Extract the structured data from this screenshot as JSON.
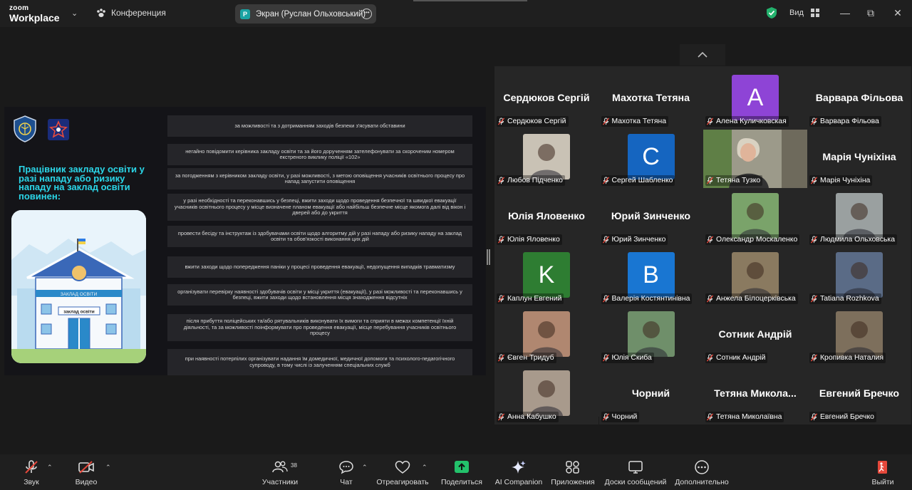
{
  "titlebar": {
    "logo_top": "zoom",
    "logo_bottom": "Workplace",
    "meeting_label": "Конференция",
    "share_initial": "P",
    "share_label": "Экран (Руслан Ольховський)",
    "view_label": "Вид"
  },
  "slide": {
    "title": "Працівник закладу освіти у разі нападу або ризику нападу на заклад освіти повинен:",
    "school_label": "заклад освіти",
    "banner_text": "ЗАКЛАД ОСВІТИ",
    "rows": [
      "за можливості та з дотриманням заходів безпеки з'ясувати обставини",
      "негайно повідомити керівника закладу освіти та за його дорученням  зателефонувати за скороченим номером екстреного виклику поліції «102»",
      "за погодженням з керівником закладу освіти, у разі можливості, з метою оповіщення учасників освітнього процесу про напад запустити оповіщення",
      "у разі необхідності та переконавшись у безпеці, вжити заходи щодо проведення безпечної та швидкої евакуації учасників освітнього процесу у місце визначене планом евакуації або найбільш безпечне місце якомога далі від вікон і дверей або до укриття",
      "провести бесіду та інструктаж із здобувачами освіти щодо алгоритму дій у разі нападу або ризику нападу на заклад освіти та обов'язкості виконання цих дій",
      "вжити заходи щодо попередження паніки у процесі проведення евакуації, недопущення випадків травматизму",
      "організувати перевірку наявності здобувачів освіти у місці укриття (евакуації), у разі можливості та переконавшись у безпеці, вжити заходи щодо встановлення місця знаходження відсутніх",
      "після прибуття поліцейських та/або рятувальників виконувати їх вимоги та сприяти в межах компетенції їхній діяльності, та за можливості поінформувати про проведення евакуації, місце перебування учасників освітнього процесу",
      "при наявності потерпілих організувати надання їм домедичної, медичної допомоги та психолого-педагогічного супроводу, в тому числі із залученням спеціальних служб"
    ]
  },
  "participants": [
    {
      "name": "Сердюков Сергій",
      "display": "Сердюков  Сергій",
      "kind": "name"
    },
    {
      "name": "Махотка Тетяна",
      "display": "Махотка Тетяна",
      "kind": "name"
    },
    {
      "name": "Алена Куличковская",
      "letter": "A",
      "color": "#8e44d6",
      "kind": "letter"
    },
    {
      "name": "Варвара Фільова",
      "display": "Варвара Фільова",
      "kind": "name"
    },
    {
      "name": "Любов Підченко",
      "kind": "photo",
      "color": "#c9c2b5"
    },
    {
      "name": "Сергей Шабленко",
      "letter": "C",
      "color": "#1565c0",
      "kind": "letter"
    },
    {
      "name": "Тетяна Тузко",
      "kind": "video",
      "color": "#8a8a82"
    },
    {
      "name": "Марія Чуніхіна",
      "display": "Марія Чуніхіна",
      "kind": "name"
    },
    {
      "name": "Юлія Яловенко",
      "display": "Юлія Яловенко",
      "kind": "name"
    },
    {
      "name": "Юрий Зинченко",
      "display": "Юрий Зинченко",
      "kind": "name"
    },
    {
      "name": "Олександр Москаленко",
      "kind": "photo",
      "color": "#7aa36a"
    },
    {
      "name": "Людмила Ольховська",
      "kind": "photo",
      "color": "#9aa0a0"
    },
    {
      "name": "Каплун Евгений",
      "letter": "K",
      "color": "#2e7d32",
      "kind": "letter"
    },
    {
      "name": "Валерія Костянтинівна",
      "letter": "B",
      "color": "#1976d2",
      "kind": "letter"
    },
    {
      "name": "Анжела Білоцерківська",
      "kind": "photo",
      "color": "#8a7a60"
    },
    {
      "name": "Tatiana Rozhkova",
      "kind": "photo",
      "color": "#5a6b86"
    },
    {
      "name": "Євген Тридуб",
      "kind": "photo",
      "color": "#b08770"
    },
    {
      "name": "Юлія Скиба",
      "kind": "photo",
      "color": "#6f8f6a"
    },
    {
      "name": "Сотник Андрій",
      "display": "Сотник Андрій",
      "kind": "name"
    },
    {
      "name": "Кропивка Наталия",
      "kind": "photo",
      "color": "#7d6f5c"
    },
    {
      "name": "Анна Кабушко",
      "kind": "photo",
      "color": "#a89a8c"
    },
    {
      "name": "Чорний",
      "display": "Чорний",
      "kind": "name"
    },
    {
      "name": "Тетяна Миколаївна",
      "display": "Тетяна  Микола...",
      "kind": "name"
    },
    {
      "name": "Евгений Бречко",
      "display": "Евгений Бречко",
      "kind": "name"
    }
  ],
  "toolbar": {
    "audio": "Звук",
    "video": "Видео",
    "participants": "Участники",
    "participants_count": "38",
    "chat": "Чат",
    "react": "Отреагировать",
    "share": "Поделиться",
    "ai": "AI Companion",
    "apps": "Приложения",
    "whiteboards": "Доски сообщений",
    "more": "Дополнительно",
    "leave": "Выйти"
  }
}
